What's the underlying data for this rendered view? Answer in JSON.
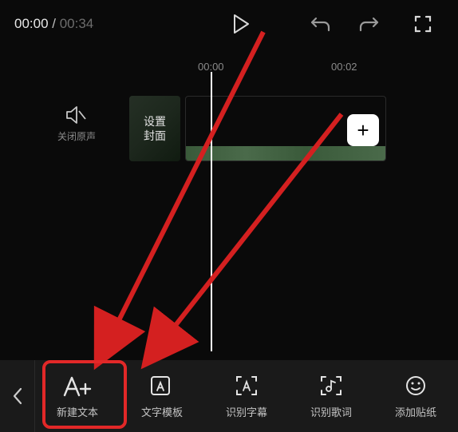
{
  "header": {
    "time_current": "00:00",
    "time_separator": " / ",
    "time_total": "00:34"
  },
  "ruler": {
    "ticks": [
      "00:00",
      "00:02"
    ]
  },
  "timeline": {
    "mute_label": "关闭原声",
    "cover_label_line1": "设置",
    "cover_label_line2": "封面"
  },
  "toolbar": {
    "items": [
      {
        "label": "新建文本",
        "icon": "text-add-icon"
      },
      {
        "label": "文字模板",
        "icon": "text-template-icon"
      },
      {
        "label": "识别字幕",
        "icon": "recognize-subtitle-icon"
      },
      {
        "label": "识别歌词",
        "icon": "recognize-lyrics-icon"
      },
      {
        "label": "添加贴纸",
        "icon": "sticker-icon"
      }
    ]
  },
  "annotations": {
    "highlight_target": "new-text-button"
  }
}
